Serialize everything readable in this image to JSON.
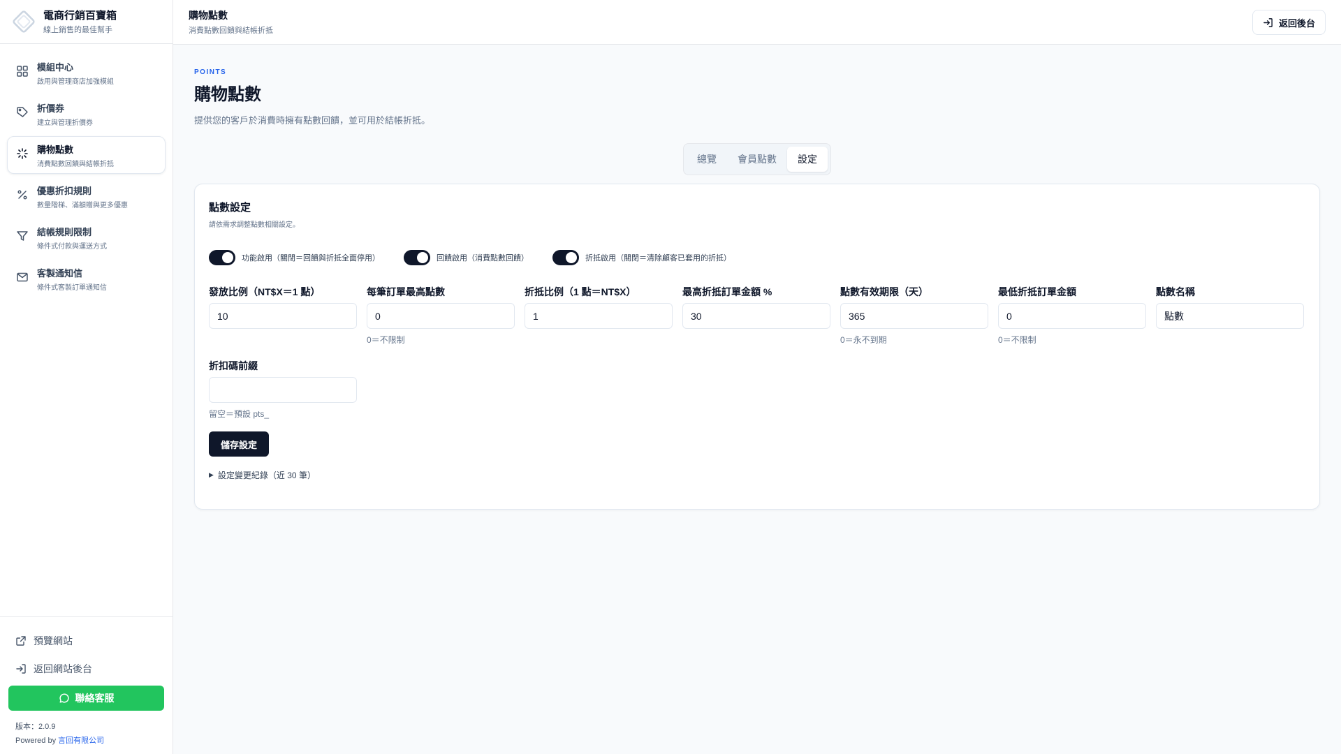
{
  "brand": {
    "title": "電商行銷百寶箱",
    "subtitle": "線上銷售的最佳幫手"
  },
  "sidebar": {
    "items": [
      {
        "label": "模組中心",
        "desc": "啟用與管理商店加強模組",
        "icon": "grid-icon"
      },
      {
        "label": "折價券",
        "desc": "建立與管理折價券",
        "icon": "tag-icon"
      },
      {
        "label": "購物點數",
        "desc": "消費點數回饋與結帳折抵",
        "icon": "sparkle-icon",
        "active": true
      },
      {
        "label": "優惠折扣規則",
        "desc": "數量階梯、滿額贈與更多優惠",
        "icon": "percent-icon"
      },
      {
        "label": "結帳規則限制",
        "desc": "條件式付款與運送方式",
        "icon": "filter-icon"
      },
      {
        "label": "客製通知信",
        "desc": "條件式客製訂單通知信",
        "icon": "mail-icon"
      }
    ],
    "footer": {
      "preview_label": "預覽網站",
      "back_label": "返回網站後台",
      "contact_label": "聯絡客服",
      "version": "版本：2.0.9",
      "powered_prefix": "Powered by",
      "powered_company": "言回有限公司"
    }
  },
  "header": {
    "title": "購物點數",
    "subtitle": "消費點數回饋與結帳折抵",
    "back_button": "返回後台"
  },
  "page": {
    "eyebrow": "POINTS",
    "title": "購物點數",
    "description": "提供您的客戶於消費時擁有點數回饋，並可用於結帳折抵。"
  },
  "tabs": [
    {
      "label": "總覽",
      "active": false
    },
    {
      "label": "會員點數",
      "active": false
    },
    {
      "label": "設定",
      "active": true
    }
  ],
  "settings": {
    "title": "點數設定",
    "subtitle": "請依需求調整點數相關設定。",
    "toggles": [
      {
        "label": "功能啟用（關閉＝回饋與折抵全面停用）",
        "on": true
      },
      {
        "label": "回饋啟用（消費點數回饋）",
        "on": true
      },
      {
        "label": "折抵啟用（關閉＝清除顧客已套用的折抵）",
        "on": true
      }
    ],
    "fields": [
      {
        "label": "發放比例（NT$X＝1 點）",
        "value": "10",
        "hint": ""
      },
      {
        "label": "每筆訂單最高點數",
        "value": "0",
        "hint": "0＝不限制"
      },
      {
        "label": "折抵比例（1 點＝NT$X）",
        "value": "1",
        "hint": ""
      },
      {
        "label": "最高折抵訂單金額 %",
        "value": "30",
        "hint": ""
      },
      {
        "label": "點數有效期限（天）",
        "value": "365",
        "hint": "0＝永不到期"
      },
      {
        "label": "最低折抵訂單金額",
        "value": "0",
        "hint": "0＝不限制"
      },
      {
        "label": "點數名稱",
        "value": "點數",
        "hint": ""
      }
    ],
    "prefix_field": {
      "label": "折扣碼前綴",
      "value": "",
      "placeholder": "",
      "hint": "留空＝預設 pts_"
    },
    "save_label": "儲存設定",
    "changelog_label": "設定變更紀錄（近 30 筆）"
  },
  "colors": {
    "primary": "#0f172a",
    "accent_blue": "#2563eb",
    "contact_green": "#22c55e"
  }
}
